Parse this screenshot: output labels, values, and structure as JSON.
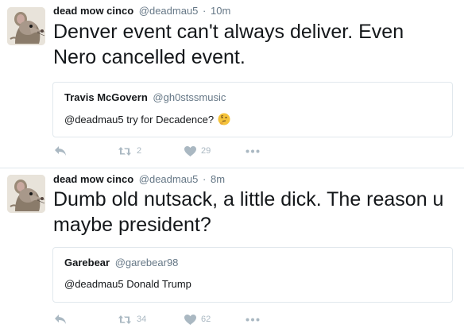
{
  "tweets": [
    {
      "author_name": "dead mow cinco",
      "author_handle": "@deadmau5",
      "separator": "·",
      "time": "10m",
      "text": "Denver event can't always deliver. Even Nero cancelled event.",
      "quote": {
        "name": "Travis McGovern",
        "handle": "@gh0stssmusic",
        "text": "@deadmau5 try for Decadence?",
        "emoji": "thinking-face-icon"
      },
      "retweets": "2",
      "likes": "29"
    },
    {
      "author_name": "dead mow cinco",
      "author_handle": "@deadmau5",
      "separator": "·",
      "time": "8m",
      "text": "Dumb old nutsack, a little dick. The reason u maybe president?",
      "quote": {
        "name": "Garebear",
        "handle": "@garebear98",
        "text": "@deadmau5 Donald Trump"
      },
      "retweets": "34",
      "likes": "62"
    }
  ],
  "icons": {
    "reply": "reply-icon",
    "retweet": "retweet-icon",
    "like": "heart-icon",
    "more": "more-dots-icon"
  },
  "colors": {
    "text": "#14171a",
    "muted": "#657786",
    "action_icons": "#aab8c2",
    "border": "#e1e8ed"
  }
}
